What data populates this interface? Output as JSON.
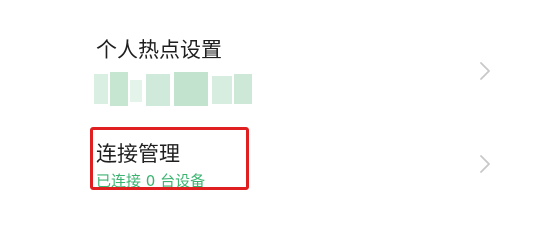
{
  "settings_list": {
    "hotspot_row": {
      "title": "个人热点设置",
      "value_redacted": true,
      "chevron_icon": "chevron-right-icon"
    },
    "connection_row": {
      "title": "连接管理",
      "subtitle": "已连接 0 台设备",
      "chevron_icon": "chevron-right-icon"
    }
  },
  "colors": {
    "title_text": "#1f1f1f",
    "subtitle_text": "#3cb371",
    "chevron": "#c8c8c8",
    "highlight_outline": "#e02020"
  }
}
